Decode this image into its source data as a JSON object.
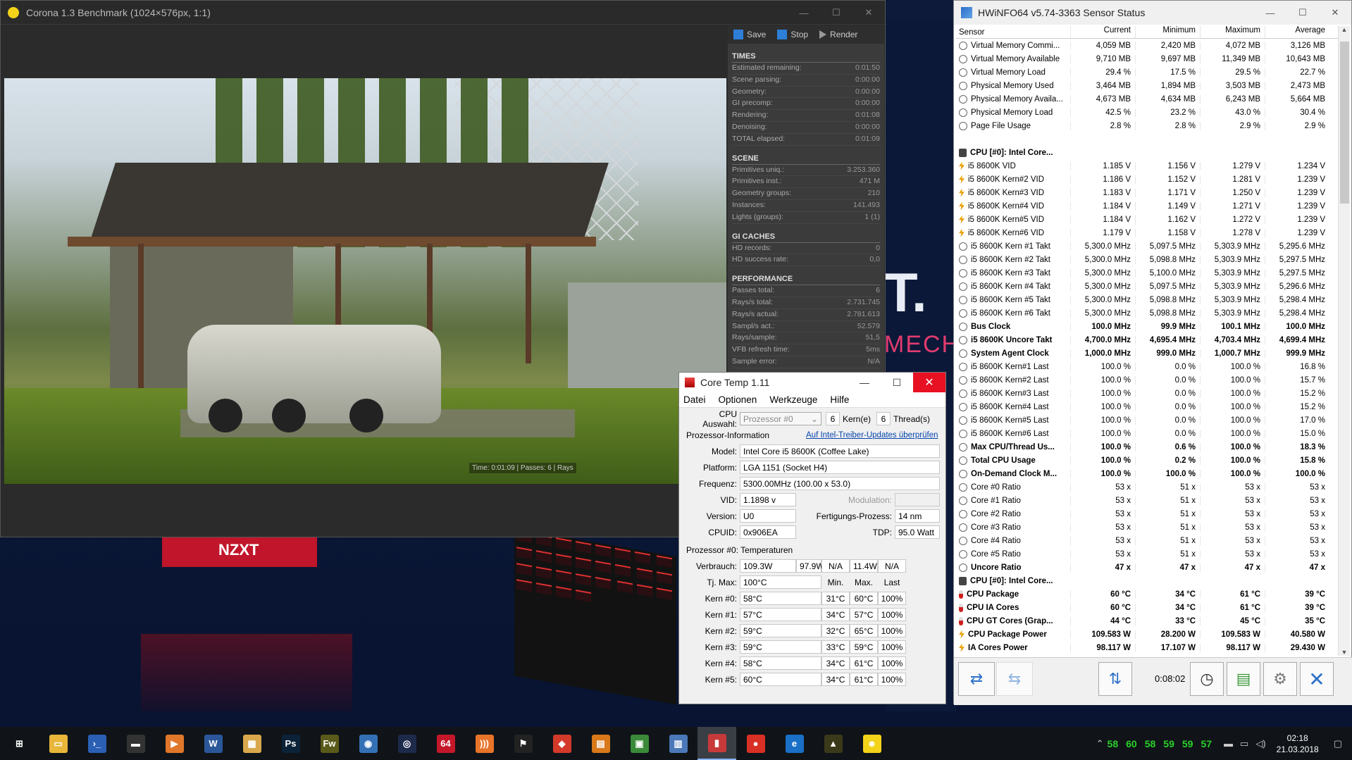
{
  "colors": {
    "accent": "#2d7fd8",
    "close_red": "#e81123",
    "tray_temp": "#29d129"
  },
  "desktop": {
    "big_text": "T.",
    "mech_text": "MECHA",
    "card_text": "NZXT"
  },
  "corona": {
    "title": "Corona 1.3 Benchmark (1024×576px, 1:1)",
    "toolbar": {
      "save": "Save",
      "stop": "Stop",
      "render": "Render"
    },
    "render_status": "Time: 0:01:09 | Passes: 6 | Rays",
    "sections": [
      {
        "title": "TIMES",
        "rows": [
          {
            "label": "Estimated remaining:",
            "value": "0:01:50"
          },
          {
            "label": "Scene parsing:",
            "value": "0:00:00"
          },
          {
            "label": "Geometry:",
            "value": "0:00:00"
          },
          {
            "label": "GI precomp:",
            "value": "0:00:00"
          },
          {
            "label": "Rendering:",
            "value": "0:01:08"
          },
          {
            "label": "Denoising:",
            "value": "0:00:00"
          },
          {
            "label": "TOTAL elapsed:",
            "value": "0:01:09"
          }
        ]
      },
      {
        "title": "SCENE",
        "rows": [
          {
            "label": "Primitives uniq.:",
            "value": "3.253.360"
          },
          {
            "label": "Primitives inst.:",
            "value": "471 M"
          },
          {
            "label": "Geometry groups:",
            "value": "210"
          },
          {
            "label": "Instances:",
            "value": "141.493"
          },
          {
            "label": "Lights (groups):",
            "value": "1 (1)"
          }
        ]
      },
      {
        "title": "GI CACHES",
        "rows": [
          {
            "label": "HD records:",
            "value": "0"
          },
          {
            "label": "HD success rate:",
            "value": "0,0"
          }
        ]
      },
      {
        "title": "PERFORMANCE",
        "rows": [
          {
            "label": "Passes total:",
            "value": "6"
          },
          {
            "label": "Rays/s total:",
            "value": "2.731.745"
          },
          {
            "label": "Rays/s actual:",
            "value": "2.781.613"
          },
          {
            "label": "Sampl/s act.:",
            "value": "52.579"
          },
          {
            "label": "Rays/sample:",
            "value": "51,5"
          },
          {
            "label": "VFB refresh time:",
            "value": "5ms"
          },
          {
            "label": "Sample error:",
            "value": "N/A"
          }
        ]
      }
    ]
  },
  "hwinfo": {
    "title": "HWiNFO64 v5.74-3363 Sensor Status",
    "columns": [
      "Sensor",
      "Current",
      "Minimum",
      "Maximum",
      "Average"
    ],
    "elapsed": "0:08:02",
    "rows": [
      {
        "icon": "circle",
        "name": "Virtual Memory Commi...",
        "v": [
          "4,059 MB",
          "2,420 MB",
          "4,072 MB",
          "3,126 MB"
        ]
      },
      {
        "icon": "circle",
        "name": "Virtual Memory Available",
        "v": [
          "9,710 MB",
          "9,697 MB",
          "11,349 MB",
          "10,643 MB"
        ]
      },
      {
        "icon": "circle",
        "name": "Virtual Memory Load",
        "v": [
          "29.4 %",
          "17.5 %",
          "29.5 %",
          "22.7 %"
        ]
      },
      {
        "icon": "circle",
        "name": "Physical Memory Used",
        "v": [
          "3,464 MB",
          "1,894 MB",
          "3,503 MB",
          "2,473 MB"
        ]
      },
      {
        "icon": "circle",
        "name": "Physical Memory Availa...",
        "v": [
          "4,673 MB",
          "4,634 MB",
          "6,243 MB",
          "5,664 MB"
        ]
      },
      {
        "icon": "circle",
        "name": "Physical Memory Load",
        "v": [
          "42.5 %",
          "23.2 %",
          "43.0 %",
          "30.4 %"
        ]
      },
      {
        "icon": "circle",
        "name": "Page File Usage",
        "v": [
          "2.8 %",
          "2.8 %",
          "2.9 %",
          "2.9 %"
        ]
      },
      {
        "icon": "spacer",
        "name": "",
        "v": [
          "",
          "",
          "",
          ""
        ]
      },
      {
        "icon": "chip",
        "group": true,
        "name": "CPU [#0]: Intel Core...",
        "v": [
          "",
          "",
          "",
          ""
        ]
      },
      {
        "icon": "bolt",
        "name": "i5 8600K VID",
        "v": [
          "1.185 V",
          "1.156 V",
          "1.279 V",
          "1.234 V"
        ]
      },
      {
        "icon": "bolt",
        "name": "i5 8600K Kern#2 VID",
        "v": [
          "1.186 V",
          "1.152 V",
          "1.281 V",
          "1.239 V"
        ]
      },
      {
        "icon": "bolt",
        "name": "i5 8600K Kern#3 VID",
        "v": [
          "1.183 V",
          "1.171 V",
          "1.250 V",
          "1.239 V"
        ]
      },
      {
        "icon": "bolt",
        "name": "i5 8600K Kern#4 VID",
        "v": [
          "1.184 V",
          "1.149 V",
          "1.271 V",
          "1.239 V"
        ]
      },
      {
        "icon": "bolt",
        "name": "i5 8600K Kern#5 VID",
        "v": [
          "1.184 V",
          "1.162 V",
          "1.272 V",
          "1.239 V"
        ]
      },
      {
        "icon": "bolt",
        "name": "i5 8600K Kern#6 VID",
        "v": [
          "1.179 V",
          "1.158 V",
          "1.278 V",
          "1.239 V"
        ]
      },
      {
        "icon": "circle",
        "name": "i5 8600K Kern #1 Takt",
        "v": [
          "5,300.0 MHz",
          "5,097.5 MHz",
          "5,303.9 MHz",
          "5,295.6 MHz"
        ]
      },
      {
        "icon": "circle",
        "name": "i5 8600K Kern #2 Takt",
        "v": [
          "5,300.0 MHz",
          "5,098.8 MHz",
          "5,303.9 MHz",
          "5,297.5 MHz"
        ]
      },
      {
        "icon": "circle",
        "name": "i5 8600K Kern #3 Takt",
        "v": [
          "5,300.0 MHz",
          "5,100.0 MHz",
          "5,303.9 MHz",
          "5,297.5 MHz"
        ]
      },
      {
        "icon": "circle",
        "name": "i5 8600K Kern #4 Takt",
        "v": [
          "5,300.0 MHz",
          "5,097.5 MHz",
          "5,303.9 MHz",
          "5,296.6 MHz"
        ]
      },
      {
        "icon": "circle",
        "name": "i5 8600K Kern #5 Takt",
        "v": [
          "5,300.0 MHz",
          "5,098.8 MHz",
          "5,303.9 MHz",
          "5,298.4 MHz"
        ]
      },
      {
        "icon": "circle",
        "name": "i5 8600K Kern #6 Takt",
        "v": [
          "5,300.0 MHz",
          "5,098.8 MHz",
          "5,303.9 MHz",
          "5,298.4 MHz"
        ]
      },
      {
        "icon": "circle",
        "bold": true,
        "name": "Bus Clock",
        "v": [
          "100.0 MHz",
          "99.9 MHz",
          "100.1 MHz",
          "100.0 MHz"
        ]
      },
      {
        "icon": "circle",
        "bold": true,
        "name": "i5 8600K Uncore Takt",
        "v": [
          "4,700.0 MHz",
          "4,695.4 MHz",
          "4,703.4 MHz",
          "4,699.4 MHz"
        ]
      },
      {
        "icon": "circle",
        "bold": true,
        "name": "System Agent Clock",
        "v": [
          "1,000.0 MHz",
          "999.0 MHz",
          "1,000.7 MHz",
          "999.9 MHz"
        ]
      },
      {
        "icon": "circle",
        "name": "i5 8600K Kern#1 Last",
        "v": [
          "100.0 %",
          "0.0 %",
          "100.0 %",
          "16.8 %"
        ]
      },
      {
        "icon": "circle",
        "name": "i5 8600K Kern#2 Last",
        "v": [
          "100.0 %",
          "0.0 %",
          "100.0 %",
          "15.7 %"
        ]
      },
      {
        "icon": "circle",
        "name": "i5 8600K Kern#3 Last",
        "v": [
          "100.0 %",
          "0.0 %",
          "100.0 %",
          "15.2 %"
        ]
      },
      {
        "icon": "circle",
        "name": "i5 8600K Kern#4 Last",
        "v": [
          "100.0 %",
          "0.0 %",
          "100.0 %",
          "15.2 %"
        ]
      },
      {
        "icon": "circle",
        "name": "i5 8600K Kern#5 Last",
        "v": [
          "100.0 %",
          "0.0 %",
          "100.0 %",
          "17.0 %"
        ]
      },
      {
        "icon": "circle",
        "name": "i5 8600K Kern#6 Last",
        "v": [
          "100.0 %",
          "0.0 %",
          "100.0 %",
          "15.0 %"
        ]
      },
      {
        "icon": "circle",
        "bold": true,
        "name": "Max CPU/Thread Us...",
        "v": [
          "100.0 %",
          "0.6 %",
          "100.0 %",
          "18.3 %"
        ]
      },
      {
        "icon": "circle",
        "bold": true,
        "name": "Total CPU Usage",
        "v": [
          "100.0 %",
          "0.2 %",
          "100.0 %",
          "15.8 %"
        ]
      },
      {
        "icon": "circle",
        "bold": true,
        "name": "On-Demand Clock M...",
        "v": [
          "100.0 %",
          "100.0 %",
          "100.0 %",
          "100.0 %"
        ]
      },
      {
        "icon": "circle",
        "name": "Core #0 Ratio",
        "v": [
          "53 x",
          "51 x",
          "53 x",
          "53 x"
        ]
      },
      {
        "icon": "circle",
        "name": "Core #1 Ratio",
        "v": [
          "53 x",
          "51 x",
          "53 x",
          "53 x"
        ]
      },
      {
        "icon": "circle",
        "name": "Core #2 Ratio",
        "v": [
          "53 x",
          "51 x",
          "53 x",
          "53 x"
        ]
      },
      {
        "icon": "circle",
        "name": "Core #3 Ratio",
        "v": [
          "53 x",
          "51 x",
          "53 x",
          "53 x"
        ]
      },
      {
        "icon": "circle",
        "name": "Core #4 Ratio",
        "v": [
          "53 x",
          "51 x",
          "53 x",
          "53 x"
        ]
      },
      {
        "icon": "circle",
        "name": "Core #5 Ratio",
        "v": [
          "53 x",
          "51 x",
          "53 x",
          "53 x"
        ]
      },
      {
        "icon": "circle",
        "bold": true,
        "name": "Uncore Ratio",
        "v": [
          "47 x",
          "47 x",
          "47 x",
          "47 x"
        ]
      },
      {
        "icon": "chip",
        "group": true,
        "name": "CPU [#0]: Intel Core...",
        "v": [
          "",
          "",
          "",
          ""
        ]
      },
      {
        "icon": "therm",
        "bold": true,
        "name": "CPU Package",
        "v": [
          "60 °C",
          "34 °C",
          "61 °C",
          "39 °C"
        ]
      },
      {
        "icon": "therm",
        "bold": true,
        "name": "CPU IA Cores",
        "v": [
          "60 °C",
          "34 °C",
          "61 °C",
          "39 °C"
        ]
      },
      {
        "icon": "therm",
        "bold": true,
        "name": "CPU GT Cores (Grap...",
        "v": [
          "44 °C",
          "33 °C",
          "45 °C",
          "35 °C"
        ]
      },
      {
        "icon": "bolt",
        "bold": true,
        "name": "CPU Package Power",
        "v": [
          "109.583 W",
          "28.200 W",
          "109.583 W",
          "40.580 W"
        ]
      },
      {
        "icon": "bolt",
        "bold": true,
        "name": "IA Cores Power",
        "v": [
          "98.117 W",
          "17.107 W",
          "98.117 W",
          "29.430 W"
        ]
      }
    ]
  },
  "coretemp": {
    "title": "Core Temp 1.11",
    "menu": [
      "Datei",
      "Optionen",
      "Werkzeuge",
      "Hilfe"
    ],
    "cpu_select_label": "CPU Auswahl:",
    "cpu_select_value": "Prozessor #0",
    "cores": "6",
    "cores_label": "Kern(e)",
    "threads": "6",
    "threads_label": "Thread(s)",
    "proc_info_label": "Prozessor-Information",
    "update_link": "Auf Intel-Treiber-Updates überprüfen",
    "model_label": "Model:",
    "model": "Intel Core i5 8600K (Coffee Lake)",
    "platform_label": "Platform:",
    "platform": "LGA 1151 (Socket H4)",
    "freq_label": "Frequenz:",
    "freq": "5300.00MHz (100.00 x 53.0)",
    "vid_label": "VID:",
    "vid": "1.1898 v",
    "modulation_label": "Modulation:",
    "version_label": "Version:",
    "version": "U0",
    "process_label": "Fertigungs-Prozess:",
    "process": "14 nm",
    "cpuid_label": "CPUID:",
    "cpuid": "0x906EA",
    "tdp_label": "TDP:",
    "tdp": "95.0 Watt",
    "temps_label": "Prozessor #0: Temperaturen",
    "power_label": "Verbrauch:",
    "power": [
      "109.3W",
      "97.9W",
      "N/A",
      "11.4W",
      "N/A"
    ],
    "tjmax_label": "Tj. Max:",
    "tjmax": "100°C",
    "col_min": "Min.",
    "col_max": "Max.",
    "col_last": "Last",
    "kerns": [
      {
        "label": "Kern #0:",
        "temp": "58°C",
        "min": "31°C",
        "max": "60°C",
        "load": "100%"
      },
      {
        "label": "Kern #1:",
        "temp": "57°C",
        "min": "34°C",
        "max": "57°C",
        "load": "100%"
      },
      {
        "label": "Kern #2:",
        "temp": "59°C",
        "min": "32°C",
        "max": "65°C",
        "load": "100%"
      },
      {
        "label": "Kern #3:",
        "temp": "59°C",
        "min": "33°C",
        "max": "59°C",
        "load": "100%"
      },
      {
        "label": "Kern #4:",
        "temp": "58°C",
        "min": "34°C",
        "max": "61°C",
        "load": "100%"
      },
      {
        "label": "Kern #5:",
        "temp": "60°C",
        "min": "34°C",
        "max": "61°C",
        "load": "100%"
      }
    ]
  },
  "taskbar": {
    "apps": [
      {
        "name": "start-button",
        "glyph": "⊞",
        "bg": "#101418"
      },
      {
        "name": "file-explorer-icon",
        "glyph": "▭",
        "bg": "#e8b73a"
      },
      {
        "name": "powershell-icon",
        "glyph": "›_",
        "bg": "#2a5fb4"
      },
      {
        "name": "terminal-icon",
        "glyph": "▬",
        "bg": "#333"
      },
      {
        "name": "media-player-icon",
        "glyph": "▶",
        "bg": "#e0772a"
      },
      {
        "name": "word-icon",
        "glyph": "W",
        "bg": "#2b579a"
      },
      {
        "name": "app-icon",
        "glyph": "▦",
        "bg": "#d9a84c"
      },
      {
        "name": "photoshop-icon",
        "glyph": "Ps",
        "bg": "#0b2238"
      },
      {
        "name": "fireworks-icon",
        "glyph": "Fw",
        "bg": "#5a5a1a"
      },
      {
        "name": "network-icon",
        "glyph": "◉",
        "bg": "#3470b5"
      },
      {
        "name": "cinema4d-icon",
        "glyph": "◎",
        "bg": "#1d2a4a"
      },
      {
        "name": "aida64-icon",
        "glyph": "64",
        "bg": "#c4182a"
      },
      {
        "name": "rss-icon",
        "glyph": ")))",
        "bg": "#e8742a"
      },
      {
        "name": "corsair-icon",
        "glyph": "⚑",
        "bg": "#222"
      },
      {
        "name": "tool-icon",
        "glyph": "◆",
        "bg": "#d33a2a"
      },
      {
        "name": "cpuz-icon",
        "glyph": "▤",
        "bg": "#d9791a"
      },
      {
        "name": "monitor-icon",
        "glyph": "▣",
        "bg": "#3a8a3a"
      },
      {
        "name": "hwinfo-taskbar-icon",
        "glyph": "▥",
        "bg": "#4a78b8"
      },
      {
        "name": "coretemp-taskbar-icon",
        "glyph": "▮",
        "bg": "#c83a3a",
        "active": true
      },
      {
        "name": "chrome-icon",
        "glyph": "●",
        "bg": "#d93025"
      },
      {
        "name": "edge-icon",
        "glyph": "e",
        "bg": "#1a6fc7"
      },
      {
        "name": "vector-icon",
        "glyph": "▲",
        "bg": "#3a3a1a"
      },
      {
        "name": "corona-taskbar-icon",
        "glyph": "☻",
        "bg": "#f3d21a"
      }
    ],
    "temps": [
      "58",
      "60",
      "58",
      "59",
      "59",
      "57"
    ],
    "time": "02:18",
    "date": "21.03.2018"
  }
}
